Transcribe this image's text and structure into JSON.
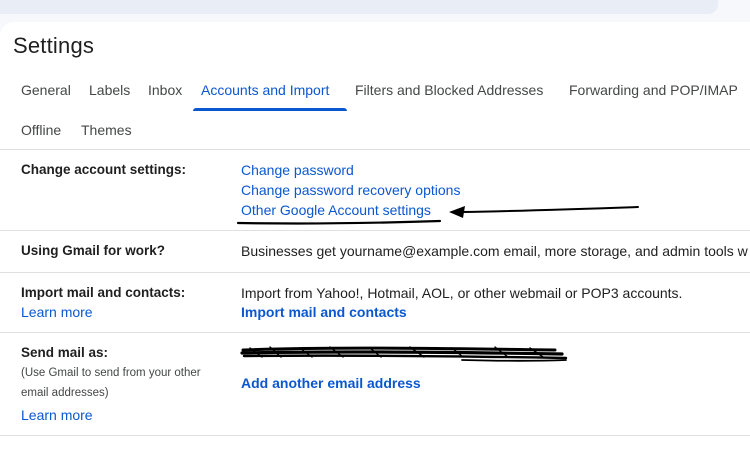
{
  "page": {
    "title": "Settings"
  },
  "tabs": [
    {
      "label": "General"
    },
    {
      "label": "Labels"
    },
    {
      "label": "Inbox"
    },
    {
      "label": "Accounts and Import"
    },
    {
      "label": "Filters and Blocked Addresses"
    },
    {
      "label": "Forwarding and POP/IMAP"
    },
    {
      "label": "Offline"
    },
    {
      "label": "Themes"
    }
  ],
  "active_tab": "Accounts and Import",
  "sections": {
    "change_account": {
      "label": "Change account settings:",
      "links": [
        "Change password",
        "Change password recovery options",
        "Other Google Account settings"
      ]
    },
    "gmail_work": {
      "label": "Using Gmail for work?",
      "text": "Businesses get yourname@example.com email, more storage, and admin tools w"
    },
    "import_mail": {
      "label": "Import mail and contacts:",
      "learn_more": "Learn more",
      "text": "Import from Yahoo!, Hotmail, AOL, or other webmail or POP3 accounts.",
      "action": "Import mail and contacts"
    },
    "send_mail": {
      "label": "Send mail as:",
      "sublabel_1": "(Use Gmail to send from your other",
      "sublabel_2": "email addresses)",
      "learn_more": "Learn more",
      "action": "Add another email address"
    }
  },
  "colors": {
    "accent": "#0b57d0",
    "text": "#1f1f1f",
    "muted": "#444746",
    "divider": "#e0e0e0"
  }
}
